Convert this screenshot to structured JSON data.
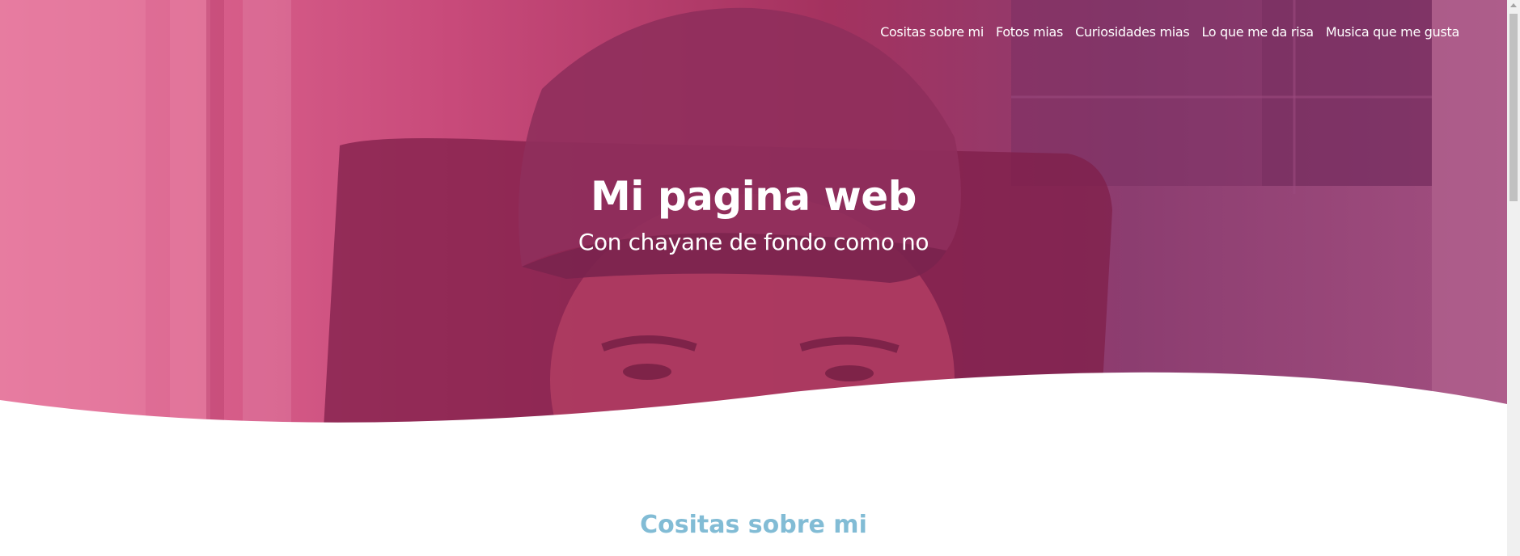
{
  "nav": {
    "items": [
      {
        "label": "Cositas sobre mi"
      },
      {
        "label": "Fotos mias"
      },
      {
        "label": "Curiosidades mias"
      },
      {
        "label": "Lo que me da risa"
      },
      {
        "label": "Musica que me gusta"
      }
    ]
  },
  "hero": {
    "title": "Mi pagina web",
    "subtitle": "Con chayane de fondo como no"
  },
  "sections": [
    {
      "title": "Cositas sobre mi"
    }
  ],
  "colors": {
    "hero_overlay": "#c84a7a",
    "section_title": "#82bcd5",
    "nav_text": "#ffffff"
  }
}
